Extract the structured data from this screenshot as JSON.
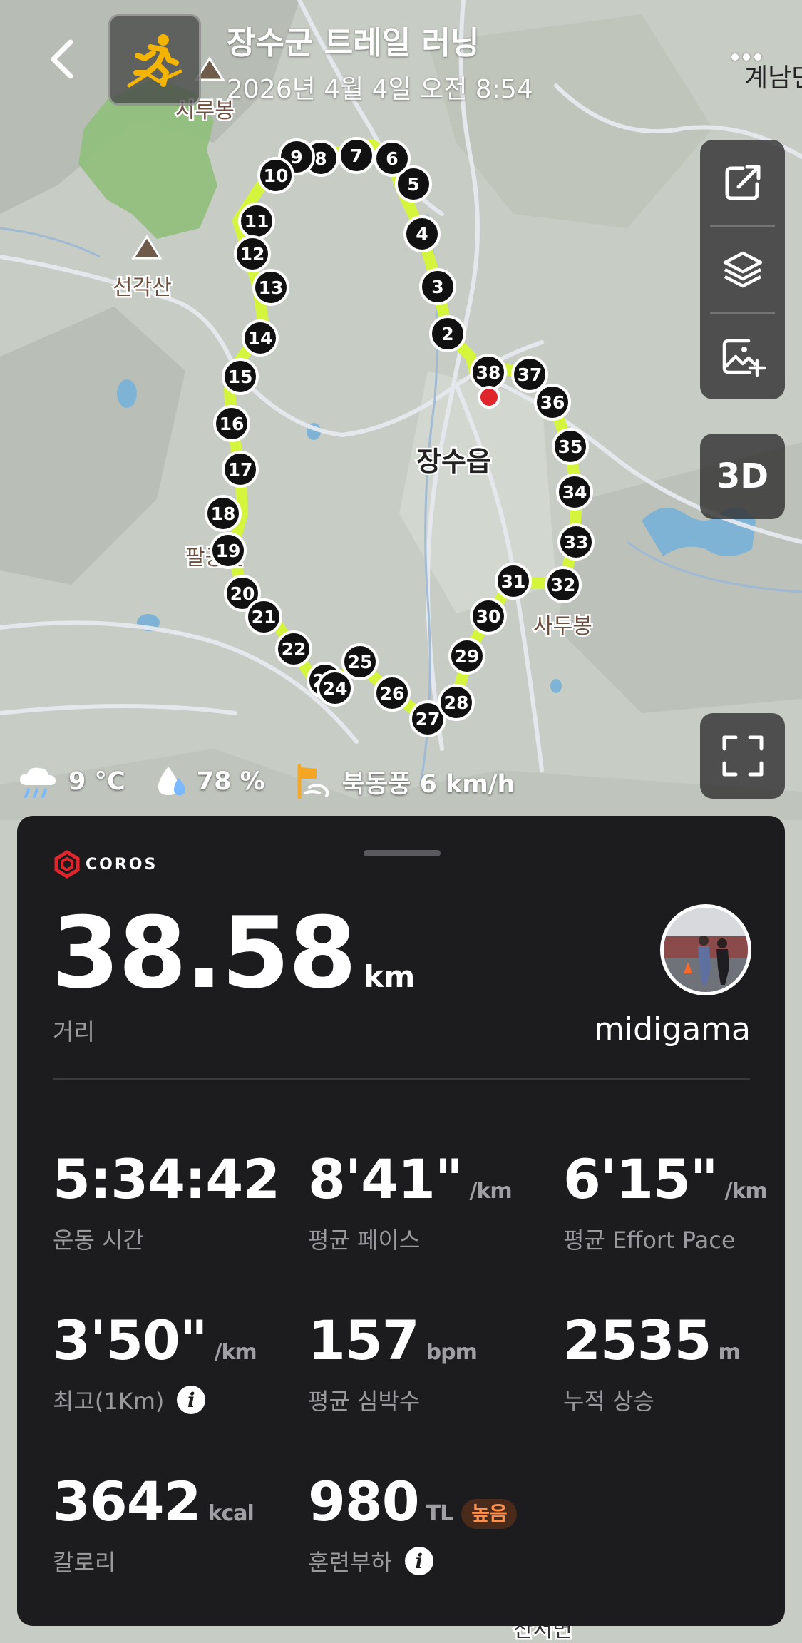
{
  "header": {
    "title": "장수군 트레일 러닝",
    "subtitle": "2026년 4월 4일 오전 8:54",
    "edge_label": "계남면"
  },
  "map": {
    "place_labels": [
      "시루봉",
      "선각산",
      "장수읍",
      "팔공산",
      "사두봉",
      "산서면"
    ],
    "km_markers": [
      "2",
      "3",
      "4",
      "5",
      "6",
      "7",
      "8",
      "9",
      "10",
      "11",
      "12",
      "13",
      "14",
      "15",
      "16",
      "17",
      "18",
      "19",
      "20",
      "21",
      "22",
      "23",
      "24",
      "25",
      "26",
      "27",
      "28",
      "29",
      "30",
      "31",
      "32",
      "33",
      "34",
      "35",
      "36",
      "37",
      "38"
    ],
    "route_color": "#d4f53c",
    "marker_color": "#111111",
    "endpoint_color": "#e0262c"
  },
  "controls": {
    "btn_3d": "3D"
  },
  "weather": {
    "temperature": "9 °C",
    "humidity": "78 %",
    "wind": "북동풍 6 km/h"
  },
  "card": {
    "brand": "COROS",
    "distance_value": "38.58",
    "distance_unit": "km",
    "distance_label": "거리",
    "username": "midigama",
    "metrics": [
      {
        "value": "5:34:42",
        "unit": "",
        "label": "운동 시간"
      },
      {
        "value": "8'41\"",
        "unit": "/km",
        "label": "평균 페이스"
      },
      {
        "value": "6'15\"",
        "unit": "/km",
        "label": "평균 Effort Pace"
      },
      {
        "value": "3'50\"",
        "unit": "/km",
        "label": "최고(1Km)"
      },
      {
        "value": "157",
        "unit": "bpm",
        "label": "평균 심박수"
      },
      {
        "value": "2535",
        "unit": "m",
        "label": "누적 상승"
      },
      {
        "value": "3642",
        "unit": "kcal",
        "label": "칼로리"
      },
      {
        "value": "980",
        "unit": "TL",
        "label": "훈련부하",
        "badge": "높음"
      }
    ]
  }
}
